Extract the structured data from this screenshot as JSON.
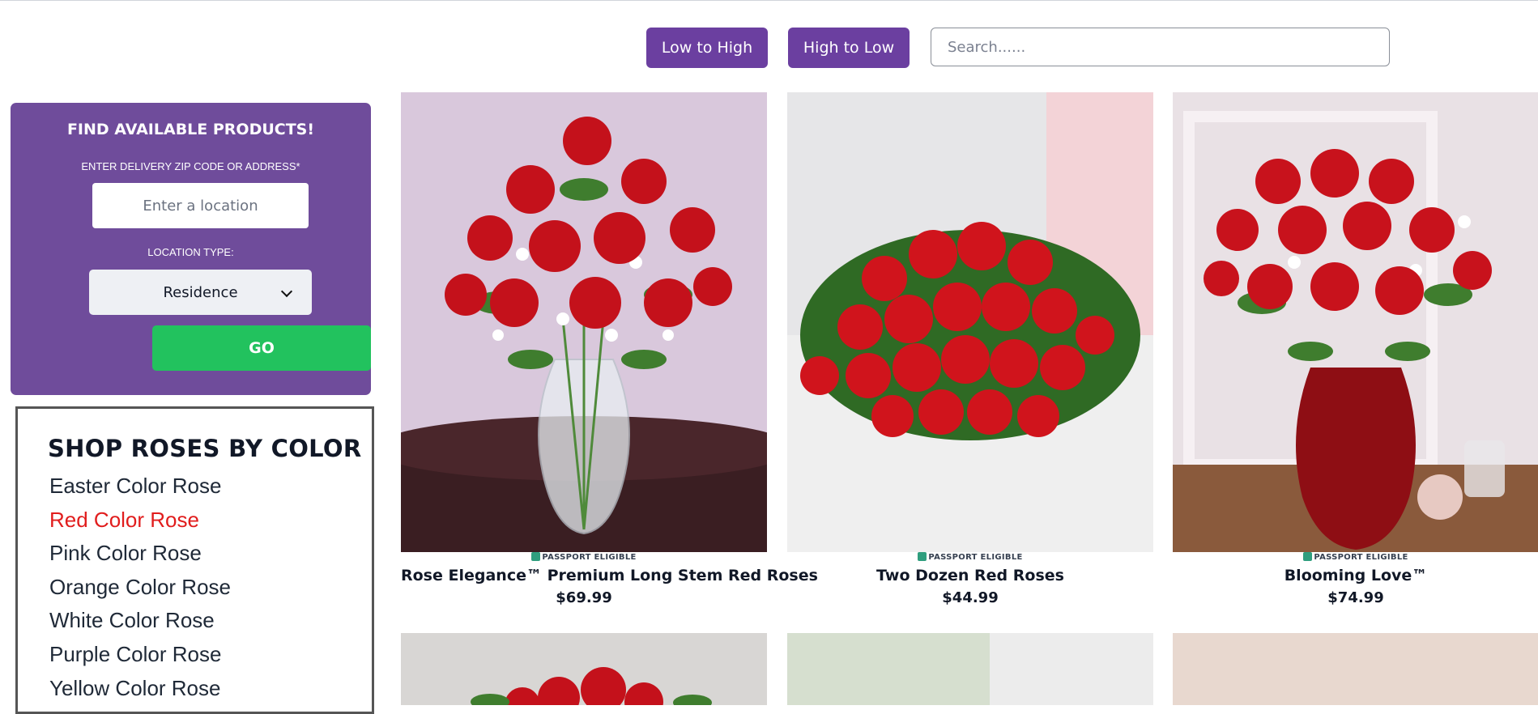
{
  "toolbar": {
    "sort_low_label": "Low to High",
    "sort_high_label": "High to Low",
    "search_placeholder": "Search......"
  },
  "finder": {
    "title": "FIND AVAILABLE PRODUCTS!",
    "zip_label": "ENTER DELIVERY ZIP CODE OR ADDRESS*",
    "zip_placeholder": "Enter a location",
    "type_label": "LOCATION TYPE:",
    "type_value": "Residence",
    "go_label": "GO"
  },
  "shop_by_color": {
    "title": "SHOP ROSES BY COLOR",
    "items": [
      {
        "label": "Easter Color Rose"
      },
      {
        "label": "Red Color Rose"
      },
      {
        "label": "Pink Color Rose"
      },
      {
        "label": "Orange Color Rose"
      },
      {
        "label": "White Color Rose"
      },
      {
        "label": "Purple Color Rose"
      },
      {
        "label": "Yellow Color Rose"
      }
    ],
    "active_item": "Red Color Rose"
  },
  "products": [
    {
      "badge": "PASSPORT ELIGIBLE",
      "name": "Rose Elegance™ Premium Long Stem Red Roses",
      "price": "$69.99"
    },
    {
      "badge": "PASSPORT ELIGIBLE",
      "name": "Two Dozen Red Roses",
      "price": "$44.99"
    },
    {
      "badge": "PASSPORT ELIGIBLE",
      "name": "Blooming Love™",
      "price": "$74.99"
    }
  ],
  "colors": {
    "accent_purple": "#6b3fa0",
    "panel_purple": "#6f4c9b",
    "go_green": "#22c25e",
    "active_red": "#e11d1d"
  }
}
